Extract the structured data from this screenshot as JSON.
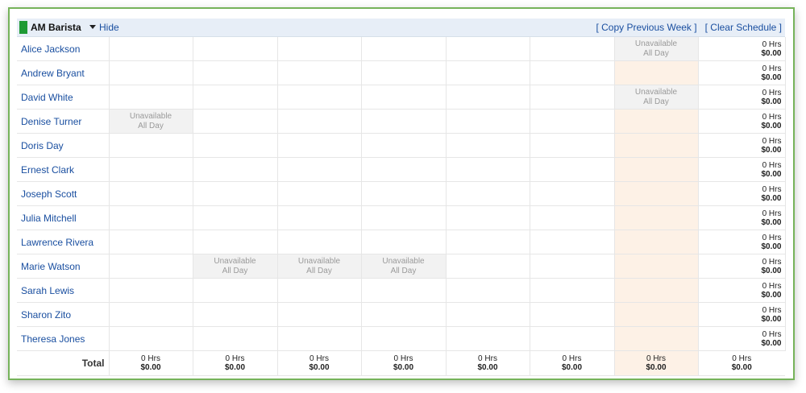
{
  "header": {
    "position": "AM Barista",
    "hide_label": "Hide",
    "copy_label": "[ Copy Previous Week ]",
    "clear_label": "[ Clear Schedule ]",
    "swatch_color": "#1f9a34"
  },
  "unavailable_line1": "Unavailable",
  "unavailable_line2": "All Day",
  "rows": [
    {
      "name": "Alice Jackson",
      "unavailable": [
        6
      ],
      "hrs": "0 Hrs",
      "cost": "$0.00"
    },
    {
      "name": "Andrew Bryant",
      "unavailable": [],
      "hrs": "0 Hrs",
      "cost": "$0.00"
    },
    {
      "name": "David White",
      "unavailable": [
        6
      ],
      "hrs": "0 Hrs",
      "cost": "$0.00"
    },
    {
      "name": "Denise Turner",
      "unavailable": [
        0
      ],
      "hrs": "0 Hrs",
      "cost": "$0.00"
    },
    {
      "name": "Doris Day",
      "unavailable": [],
      "hrs": "0 Hrs",
      "cost": "$0.00"
    },
    {
      "name": "Ernest Clark",
      "unavailable": [],
      "hrs": "0 Hrs",
      "cost": "$0.00"
    },
    {
      "name": "Joseph Scott",
      "unavailable": [],
      "hrs": "0 Hrs",
      "cost": "$0.00"
    },
    {
      "name": "Julia Mitchell",
      "unavailable": [],
      "hrs": "0 Hrs",
      "cost": "$0.00"
    },
    {
      "name": "Lawrence Rivera",
      "unavailable": [],
      "hrs": "0 Hrs",
      "cost": "$0.00"
    },
    {
      "name": "Marie Watson",
      "unavailable": [
        1,
        2,
        3
      ],
      "hrs": "0 Hrs",
      "cost": "$0.00"
    },
    {
      "name": "Sarah Lewis",
      "unavailable": [],
      "hrs": "0 Hrs",
      "cost": "$0.00"
    },
    {
      "name": "Sharon Zito",
      "unavailable": [],
      "hrs": "0 Hrs",
      "cost": "$0.00"
    },
    {
      "name": "Theresa Jones",
      "unavailable": [],
      "hrs": "0 Hrs",
      "cost": "$0.00"
    }
  ],
  "highlight_day": 6,
  "highlight_color": "#fdf1e6",
  "total": {
    "label": "Total",
    "days": [
      {
        "hrs": "0 Hrs",
        "cost": "$0.00"
      },
      {
        "hrs": "0 Hrs",
        "cost": "$0.00"
      },
      {
        "hrs": "0 Hrs",
        "cost": "$0.00"
      },
      {
        "hrs": "0 Hrs",
        "cost": "$0.00"
      },
      {
        "hrs": "0 Hrs",
        "cost": "$0.00"
      },
      {
        "hrs": "0 Hrs",
        "cost": "$0.00"
      },
      {
        "hrs": "0 Hrs",
        "cost": "$0.00"
      },
      {
        "hrs": "0 Hrs",
        "cost": "$0.00"
      }
    ]
  }
}
